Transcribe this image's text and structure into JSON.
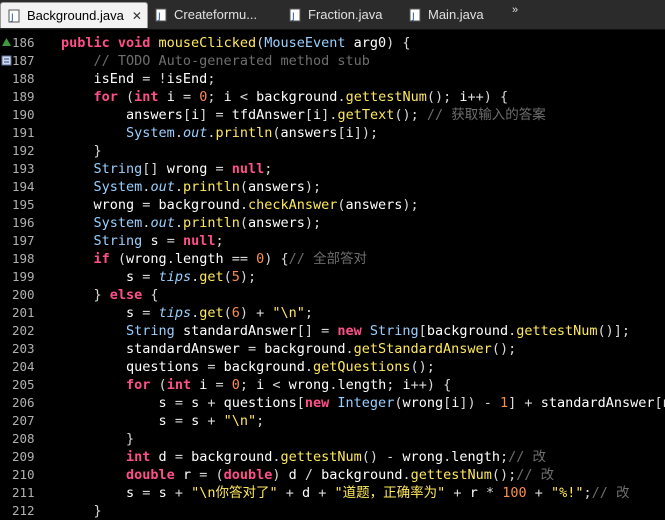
{
  "tabs": [
    {
      "label": "Background.java",
      "active": true,
      "icon": "java-file-icon"
    },
    {
      "label": "Createformu...",
      "active": false,
      "icon": "java-file-icon"
    },
    {
      "label": "Fraction.java",
      "active": false,
      "icon": "java-file-icon"
    },
    {
      "label": "Main.java",
      "active": false,
      "icon": "java-file-icon"
    }
  ],
  "overflow": "»",
  "close_glyph": "✕",
  "lines": [
    {
      "n": "186",
      "tokens": [
        [
          "kw",
          "public "
        ],
        [
          "kw",
          "void "
        ],
        [
          "fn",
          "mouseClicked"
        ],
        [
          "op",
          "("
        ],
        [
          "ty",
          "MouseEvent"
        ],
        [
          "op",
          " "
        ],
        [
          "var",
          "arg0"
        ],
        [
          "op",
          ") {"
        ]
      ]
    },
    {
      "n": "187",
      "tokens": [
        [
          "op",
          "    "
        ],
        [
          "cm",
          "// TODO Auto-generated method stub"
        ]
      ]
    },
    {
      "n": "188",
      "tokens": [
        [
          "op",
          "    "
        ],
        [
          "var",
          "isEnd"
        ],
        [
          "op",
          " = !"
        ],
        [
          "var",
          "isEnd"
        ],
        [
          "op",
          ";"
        ]
      ]
    },
    {
      "n": "189",
      "tokens": [
        [
          "op",
          "    "
        ],
        [
          "kw",
          "for "
        ],
        [
          "op",
          "("
        ],
        [
          "kw",
          "int "
        ],
        [
          "var",
          "i"
        ],
        [
          "op",
          " = "
        ],
        [
          "num",
          "0"
        ],
        [
          "op",
          "; "
        ],
        [
          "var",
          "i"
        ],
        [
          "op",
          " < "
        ],
        [
          "var",
          "background"
        ],
        [
          "op",
          "."
        ],
        [
          "fn",
          "gettestNum"
        ],
        [
          "op",
          "(); "
        ],
        [
          "var",
          "i"
        ],
        [
          "op",
          "++) {"
        ]
      ]
    },
    {
      "n": "190",
      "tokens": [
        [
          "op",
          "        "
        ],
        [
          "var",
          "answers"
        ],
        [
          "op",
          "["
        ],
        [
          "var",
          "i"
        ],
        [
          "op",
          "] = "
        ],
        [
          "var",
          "tfdAnswer"
        ],
        [
          "op",
          "["
        ],
        [
          "var",
          "i"
        ],
        [
          "op",
          "]."
        ],
        [
          "fn",
          "getText"
        ],
        [
          "op",
          "(); "
        ],
        [
          "cm",
          "// 获取输入的答案"
        ]
      ]
    },
    {
      "n": "191",
      "tokens": [
        [
          "op",
          "        "
        ],
        [
          "ty",
          "System"
        ],
        [
          "op",
          "."
        ],
        [
          "fld",
          "out"
        ],
        [
          "op",
          "."
        ],
        [
          "fn",
          "println"
        ],
        [
          "op",
          "("
        ],
        [
          "var",
          "answers"
        ],
        [
          "op",
          "["
        ],
        [
          "var",
          "i"
        ],
        [
          "op",
          "]);"
        ]
      ]
    },
    {
      "n": "192",
      "tokens": [
        [
          "op",
          "    }"
        ]
      ]
    },
    {
      "n": "193",
      "tokens": [
        [
          "op",
          "    "
        ],
        [
          "ty",
          "String"
        ],
        [
          "op",
          "[] "
        ],
        [
          "var",
          "wrong"
        ],
        [
          "op",
          " = "
        ],
        [
          "kw",
          "null"
        ],
        [
          "op",
          ";"
        ]
      ]
    },
    {
      "n": "194",
      "tokens": [
        [
          "op",
          "    "
        ],
        [
          "ty",
          "System"
        ],
        [
          "op",
          "."
        ],
        [
          "fld",
          "out"
        ],
        [
          "op",
          "."
        ],
        [
          "fn",
          "println"
        ],
        [
          "op",
          "("
        ],
        [
          "var",
          "answers"
        ],
        [
          "op",
          ");"
        ]
      ]
    },
    {
      "n": "195",
      "tokens": [
        [
          "op",
          "    "
        ],
        [
          "var",
          "wrong"
        ],
        [
          "op",
          " = "
        ],
        [
          "var",
          "background"
        ],
        [
          "op",
          "."
        ],
        [
          "fn",
          "checkAnswer"
        ],
        [
          "op",
          "("
        ],
        [
          "var",
          "answers"
        ],
        [
          "op",
          ");"
        ]
      ]
    },
    {
      "n": "196",
      "tokens": [
        [
          "op",
          "    "
        ],
        [
          "ty",
          "System"
        ],
        [
          "op",
          "."
        ],
        [
          "fld",
          "out"
        ],
        [
          "op",
          "."
        ],
        [
          "fn",
          "println"
        ],
        [
          "op",
          "("
        ],
        [
          "var",
          "answers"
        ],
        [
          "op",
          ");"
        ]
      ]
    },
    {
      "n": "197",
      "tokens": [
        [
          "op",
          "    "
        ],
        [
          "ty",
          "String"
        ],
        [
          "op",
          " "
        ],
        [
          "var",
          "s"
        ],
        [
          "op",
          " = "
        ],
        [
          "kw",
          "null"
        ],
        [
          "op",
          ";"
        ]
      ]
    },
    {
      "n": "198",
      "tokens": [
        [
          "op",
          "    "
        ],
        [
          "kw",
          "if "
        ],
        [
          "op",
          "("
        ],
        [
          "var",
          "wrong"
        ],
        [
          "op",
          "."
        ],
        [
          "var",
          "length"
        ],
        [
          "op",
          " == "
        ],
        [
          "num",
          "0"
        ],
        [
          "op",
          ") {"
        ],
        [
          "cm",
          "// 全部答对"
        ]
      ]
    },
    {
      "n": "199",
      "tokens": [
        [
          "op",
          "        "
        ],
        [
          "var",
          "s"
        ],
        [
          "op",
          " = "
        ],
        [
          "fld",
          "tips"
        ],
        [
          "op",
          "."
        ],
        [
          "fn",
          "get"
        ],
        [
          "op",
          "("
        ],
        [
          "num",
          "5"
        ],
        [
          "op",
          ");"
        ]
      ]
    },
    {
      "n": "200",
      "tokens": [
        [
          "op",
          "    } "
        ],
        [
          "kw",
          "else "
        ],
        [
          "op",
          "{"
        ]
      ]
    },
    {
      "n": "201",
      "tokens": [
        [
          "op",
          "        "
        ],
        [
          "var",
          "s"
        ],
        [
          "op",
          " = "
        ],
        [
          "fld",
          "tips"
        ],
        [
          "op",
          "."
        ],
        [
          "fn",
          "get"
        ],
        [
          "op",
          "("
        ],
        [
          "num",
          "6"
        ],
        [
          "op",
          ") + "
        ],
        [
          "str",
          "\"\\n\""
        ],
        [
          "op",
          ";"
        ]
      ]
    },
    {
      "n": "202",
      "tokens": [
        [
          "op",
          "        "
        ],
        [
          "ty",
          "String "
        ],
        [
          "var",
          "standardAnswer"
        ],
        [
          "op",
          "[] = "
        ],
        [
          "kw",
          "new "
        ],
        [
          "ty",
          "String"
        ],
        [
          "op",
          "["
        ],
        [
          "var",
          "background"
        ],
        [
          "op",
          "."
        ],
        [
          "fn",
          "gettestNum"
        ],
        [
          "op",
          "()];"
        ]
      ]
    },
    {
      "n": "203",
      "tokens": [
        [
          "op",
          "        "
        ],
        [
          "var",
          "standardAnswer"
        ],
        [
          "op",
          " = "
        ],
        [
          "var",
          "background"
        ],
        [
          "op",
          "."
        ],
        [
          "fn",
          "getStandardAnswer"
        ],
        [
          "op",
          "();"
        ]
      ]
    },
    {
      "n": "204",
      "tokens": [
        [
          "op",
          "        "
        ],
        [
          "var",
          "questions"
        ],
        [
          "op",
          " = "
        ],
        [
          "var",
          "background"
        ],
        [
          "op",
          "."
        ],
        [
          "fn",
          "getQuestions"
        ],
        [
          "op",
          "();"
        ]
      ]
    },
    {
      "n": "205",
      "tokens": [
        [
          "op",
          "        "
        ],
        [
          "kw",
          "for "
        ],
        [
          "op",
          "("
        ],
        [
          "kw",
          "int "
        ],
        [
          "var",
          "i"
        ],
        [
          "op",
          " = "
        ],
        [
          "num",
          "0"
        ],
        [
          "op",
          "; "
        ],
        [
          "var",
          "i"
        ],
        [
          "op",
          " < "
        ],
        [
          "var",
          "wrong"
        ],
        [
          "op",
          "."
        ],
        [
          "var",
          "length"
        ],
        [
          "op",
          "; "
        ],
        [
          "var",
          "i"
        ],
        [
          "op",
          "++) {"
        ]
      ]
    },
    {
      "n": "206",
      "tokens": [
        [
          "op",
          "            "
        ],
        [
          "var",
          "s"
        ],
        [
          "op",
          " = "
        ],
        [
          "var",
          "s"
        ],
        [
          "op",
          " + "
        ],
        [
          "var",
          "questions"
        ],
        [
          "op",
          "["
        ],
        [
          "kw",
          "new "
        ],
        [
          "ty",
          "Integer"
        ],
        [
          "op",
          "("
        ],
        [
          "var",
          "wrong"
        ],
        [
          "op",
          "["
        ],
        [
          "var",
          "i"
        ],
        [
          "op",
          "]) - "
        ],
        [
          "num",
          "1"
        ],
        [
          "op",
          "] + "
        ],
        [
          "var",
          "standardAnswer"
        ],
        [
          "op",
          "[ne"
        ]
      ]
    },
    {
      "n": "207",
      "tokens": [
        [
          "op",
          "            "
        ],
        [
          "var",
          "s"
        ],
        [
          "op",
          " = "
        ],
        [
          "var",
          "s"
        ],
        [
          "op",
          " + "
        ],
        [
          "str",
          "\"\\n\""
        ],
        [
          "op",
          ";"
        ]
      ]
    },
    {
      "n": "208",
      "tokens": [
        [
          "op",
          "        }"
        ]
      ]
    },
    {
      "n": "209",
      "tokens": [
        [
          "op",
          "        "
        ],
        [
          "kw",
          "int "
        ],
        [
          "var",
          "d"
        ],
        [
          "op",
          " = "
        ],
        [
          "var",
          "background"
        ],
        [
          "op",
          "."
        ],
        [
          "fn",
          "gettestNum"
        ],
        [
          "op",
          "() - "
        ],
        [
          "var",
          "wrong"
        ],
        [
          "op",
          "."
        ],
        [
          "var",
          "length"
        ],
        [
          "op",
          ";"
        ],
        [
          "cm",
          "// 改"
        ]
      ]
    },
    {
      "n": "210",
      "tokens": [
        [
          "op",
          "        "
        ],
        [
          "kw",
          "double "
        ],
        [
          "var",
          "r"
        ],
        [
          "op",
          " = ("
        ],
        [
          "kw",
          "double"
        ],
        [
          "op",
          ") "
        ],
        [
          "var",
          "d"
        ],
        [
          "op",
          " / "
        ],
        [
          "var",
          "background"
        ],
        [
          "op",
          "."
        ],
        [
          "fn",
          "gettestNum"
        ],
        [
          "op",
          "();"
        ],
        [
          "cm",
          "// 改"
        ]
      ]
    },
    {
      "n": "211",
      "tokens": [
        [
          "op",
          "        "
        ],
        [
          "var",
          "s"
        ],
        [
          "op",
          " = "
        ],
        [
          "var",
          "s"
        ],
        [
          "op",
          " + "
        ],
        [
          "str",
          "\"\\n你答对了\""
        ],
        [
          "op",
          " + "
        ],
        [
          "var",
          "d"
        ],
        [
          "op",
          " + "
        ],
        [
          "str",
          "\"道题，正确率为\""
        ],
        [
          "op",
          " + "
        ],
        [
          "var",
          "r"
        ],
        [
          "op",
          " * "
        ],
        [
          "num",
          "100"
        ],
        [
          "op",
          " + "
        ],
        [
          "str",
          "\"%!\""
        ],
        [
          "op",
          ";"
        ],
        [
          "cm",
          "// 改"
        ]
      ]
    },
    {
      "n": "212",
      "tokens": [
        [
          "op",
          "    }"
        ]
      ]
    }
  ],
  "colors": {
    "background": "#000000",
    "keyword": "#ff4f8b",
    "method": "#ffe95c",
    "type": "#9ad0ff",
    "number": "#fd8d4b",
    "comment": "#6e6e6e"
  }
}
